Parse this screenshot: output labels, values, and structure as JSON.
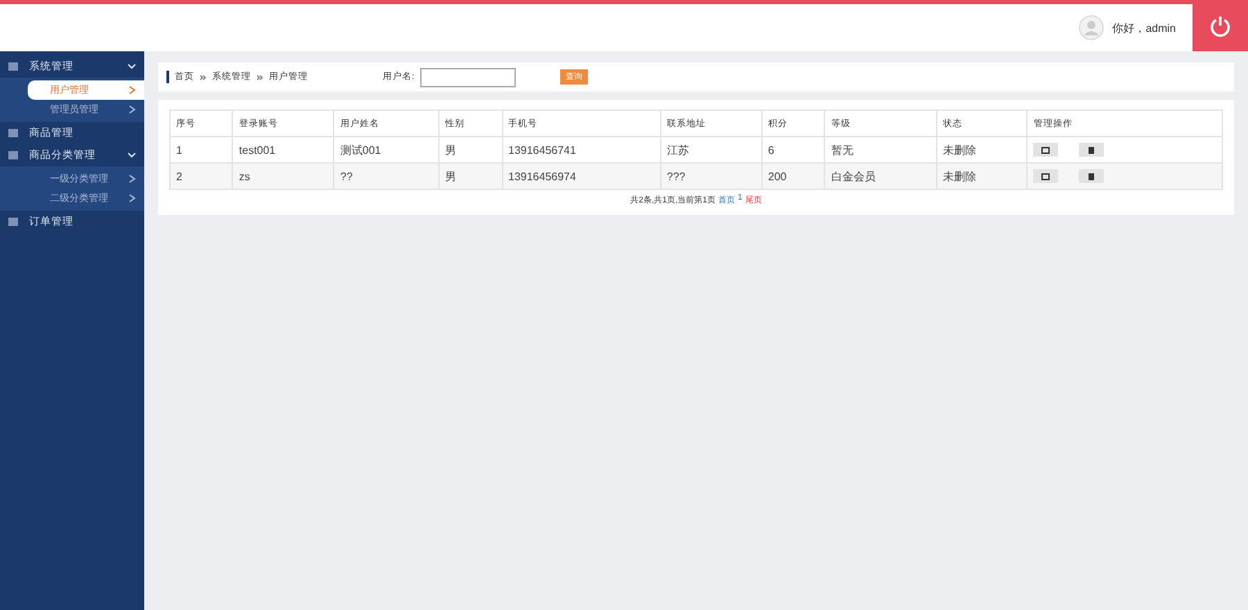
{
  "header": {
    "greeting": "你好，admin"
  },
  "sidebar": {
    "items": [
      {
        "label": "系统管理",
        "expanded": true,
        "children": [
          {
            "label": "用户管理",
            "selected": true
          },
          {
            "label": "管理员管理",
            "selected": false
          }
        ]
      },
      {
        "label": "商品管理",
        "expanded": false
      },
      {
        "label": "商品分类管理",
        "expanded": true,
        "children": [
          {
            "label": "一级分类管理",
            "selected": false
          },
          {
            "label": "二级分类管理",
            "selected": false
          }
        ]
      },
      {
        "label": "订单管理",
        "expanded": false
      }
    ]
  },
  "breadcrumb": [
    "首页",
    "系统管理",
    "用户管理"
  ],
  "search": {
    "label": "用户名:",
    "button": "查询"
  },
  "table": {
    "columns": [
      "序号",
      "登录账号",
      "用户姓名",
      "性别",
      "手机号",
      "联系地址",
      "积分",
      "等级",
      "状态",
      "管理操作"
    ],
    "rows": [
      [
        "1",
        "test001",
        "测试001",
        "男",
        "13916456741",
        "江苏",
        "6",
        "暂无",
        "未删除"
      ],
      [
        "2",
        "zs",
        "??",
        "男",
        "13916456974",
        "???",
        "200",
        "白金会员",
        "未删除"
      ]
    ]
  },
  "pagination": {
    "summary": "共2条,共1页,当前第1页",
    "links": [
      "首页",
      "1",
      "尾页"
    ]
  }
}
